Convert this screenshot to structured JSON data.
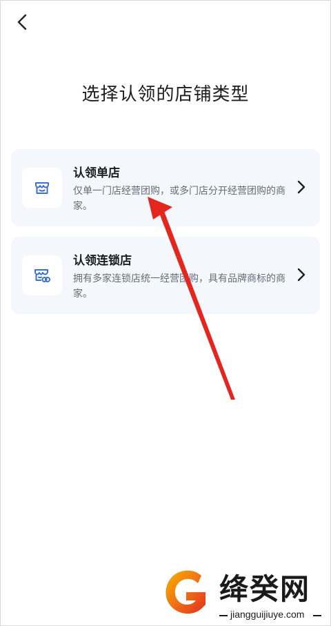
{
  "header": {
    "back_icon": "chevron-left-icon"
  },
  "page": {
    "title": "选择认领的店铺类型"
  },
  "options": [
    {
      "title": "认领单店",
      "description": "仅单一门店经营团购，或多门店分开经营团购的商家。",
      "icon": "storefront-icon",
      "chevron_icon": "chevron-right-icon"
    },
    {
      "title": "认领连锁店",
      "description": "拥有多家连锁店统一经营团购，具有品牌商标的商家。",
      "icon": "chain-store-icon",
      "chevron_icon": "chevron-right-icon"
    }
  ],
  "colors": {
    "card_background": "#f4f7fc",
    "icon_accent": "#3b6fd8",
    "annotation_red": "#e5261f"
  },
  "watermark": {
    "brand": "绛癸网",
    "url": "jiangguijiuye.com"
  }
}
